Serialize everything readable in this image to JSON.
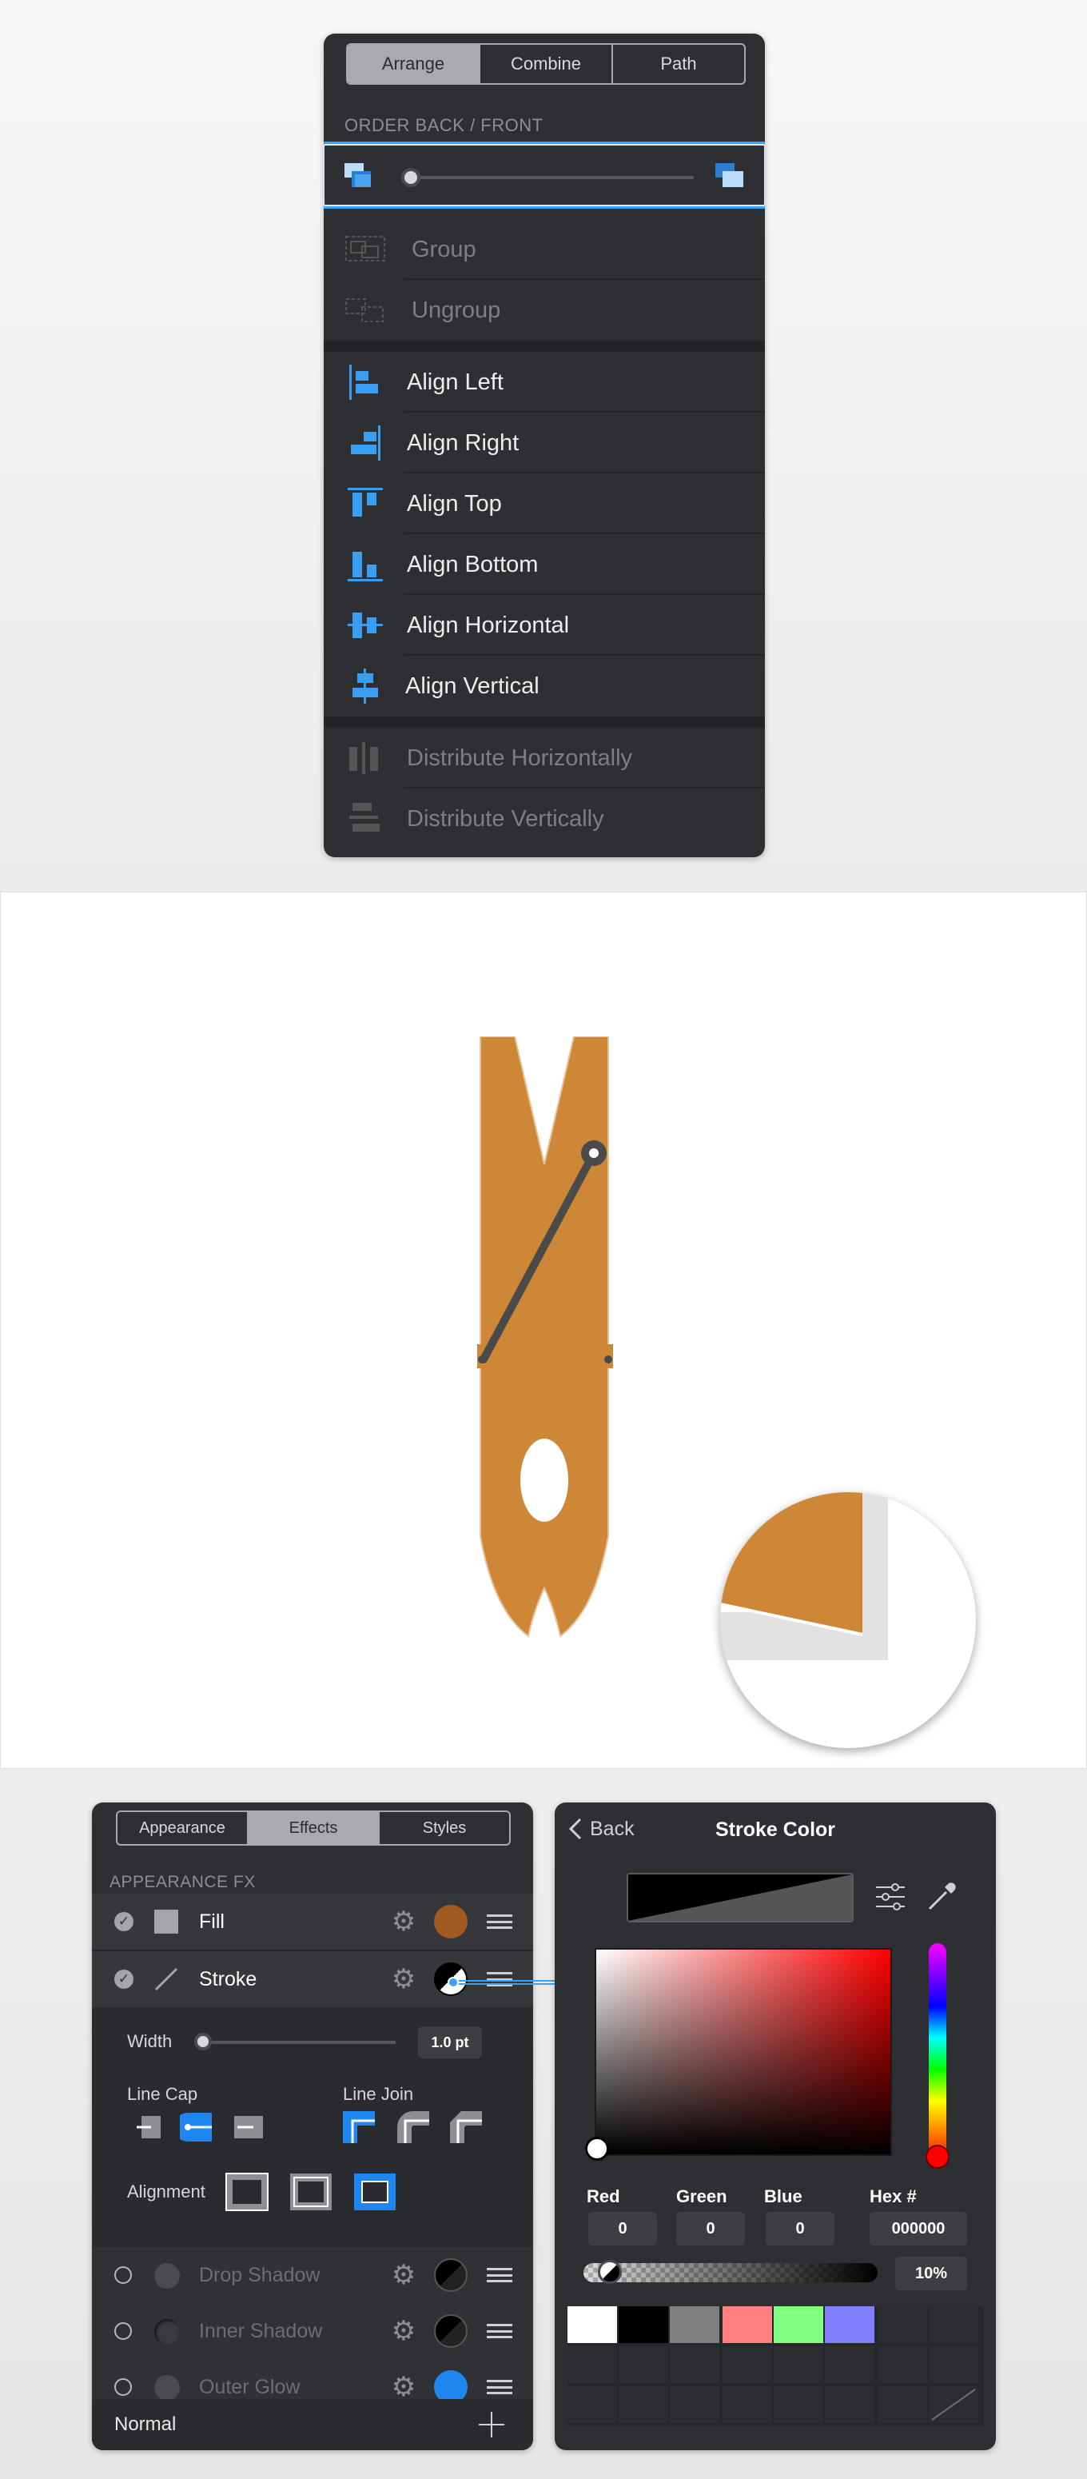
{
  "arrange_panel": {
    "tabs": [
      {
        "label": "Arrange",
        "active": true
      },
      {
        "label": "Combine",
        "active": false
      },
      {
        "label": "Path",
        "active": false
      }
    ],
    "section_label": "ORDER BACK / FRONT",
    "order_slider_value": 0.0,
    "group_items": [
      {
        "label": "Group",
        "icon": "group-icon",
        "enabled": false
      },
      {
        "label": "Ungroup",
        "icon": "ungroup-icon",
        "enabled": false
      }
    ],
    "align_items": [
      {
        "label": "Align Left",
        "icon": "align-left-icon"
      },
      {
        "label": "Align Right",
        "icon": "align-right-icon"
      },
      {
        "label": "Align Top",
        "icon": "align-top-icon"
      },
      {
        "label": "Align Bottom",
        "icon": "align-bottom-icon"
      },
      {
        "label": "Align Horizontal",
        "icon": "align-horizontal-icon"
      },
      {
        "label": "Align Vertical",
        "icon": "align-vertical-icon"
      }
    ],
    "distribute_items": [
      {
        "label": "Distribute Horizontally",
        "icon": "distribute-horizontal-icon",
        "enabled": false
      },
      {
        "label": "Distribute Vertically",
        "icon": "distribute-vertical-icon",
        "enabled": false
      }
    ]
  },
  "canvas": {
    "clothespin_color": "#cd8736",
    "spring_color": "#4a4a4a"
  },
  "effects_panel": {
    "tabs": [
      {
        "label": "Appearance",
        "active": false
      },
      {
        "label": "Effects",
        "active": true
      },
      {
        "label": "Styles",
        "active": false
      }
    ],
    "section_label": "APPEARANCE FX",
    "fill": {
      "label": "Fill",
      "color": "#a05a22",
      "checked": true
    },
    "stroke": {
      "label": "Stroke",
      "checked": true
    },
    "width": {
      "label": "Width",
      "value": "1.0 pt"
    },
    "line_cap_label": "Line Cap",
    "line_join_label": "Line Join",
    "alignment_label": "Alignment",
    "effects": [
      {
        "label": "Drop Shadow",
        "enabled": false
      },
      {
        "label": "Inner Shadow",
        "enabled": false
      },
      {
        "label": "Outer Glow",
        "enabled": false
      }
    ],
    "blend_mode": "Normal"
  },
  "stroke_color_panel": {
    "back_label": "Back",
    "title": "Stroke Color",
    "fields": [
      {
        "label": "Red",
        "value": "0"
      },
      {
        "label": "Green",
        "value": "0"
      },
      {
        "label": "Blue",
        "value": "0"
      },
      {
        "label": "Hex #",
        "value": "000000"
      }
    ],
    "opacity": "10%",
    "swatches": [
      "#ffffff",
      "#000000",
      "#808080",
      "#ff8080",
      "#80ff80",
      "#8080ff"
    ]
  }
}
